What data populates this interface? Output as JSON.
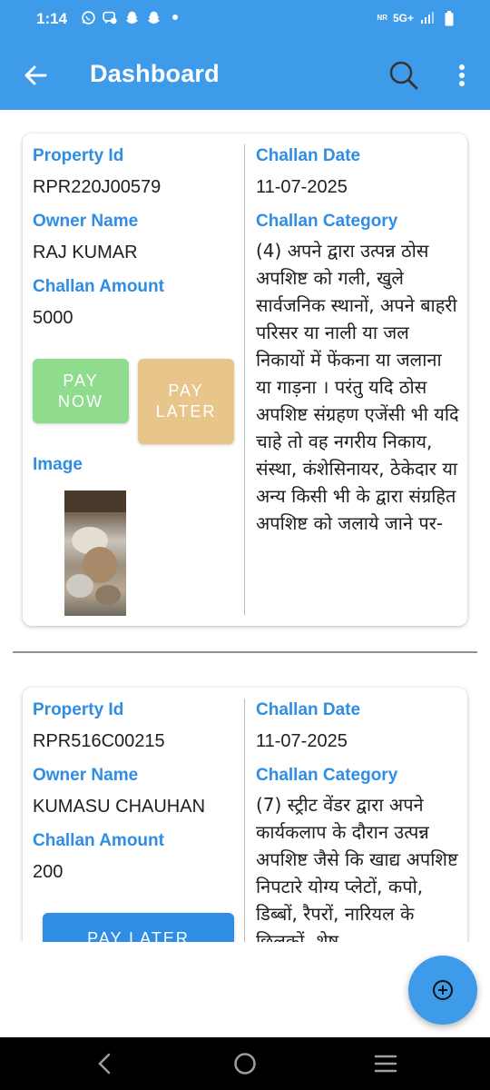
{
  "status_bar": {
    "time": "1:14",
    "left_icons": [
      "whatsapp-icon",
      "chat-icon",
      "snapchat-icon",
      "snapchat-icon",
      "dot-icon"
    ],
    "network": "5G+",
    "network_sub": "NR"
  },
  "app_bar": {
    "title": "Dashboard",
    "back_icon": "arrow-left-icon",
    "search_icon": "search-icon",
    "menu_icon": "more-vert-icon",
    "color": "#3d9be9"
  },
  "cards": [
    {
      "property_id_label": "Property Id",
      "property_id": "RPR220J00579",
      "owner_name_label": "Owner Name",
      "owner_name": "RAJ KUMAR",
      "challan_amount_label": "Challan Amount",
      "challan_amount": "5000",
      "challan_date_label": "Challan Date",
      "challan_date": "11-07-2025",
      "challan_category_label": "Challan Category",
      "challan_category": "(4) अपने द्वारा उत्पन्न ठोस अपशिष्ट को गली, खुले सार्वजनिक स्थानों, अपने बाहरी परिसर या नाली या जल निकायों में फेंकना या जलाना या गाड़ना । परंतु यदि ठोस अपशिष्ट संग्रहण एजेंसी भी यदि चाहे तो वह नगरीय निकाय, संस्था, कंशेसिनायर, ठेकेदार या अन्य किसी भी के द्वारा संग्रहित अपशिष्ट को जलाये जाने पर-",
      "pay_now_label": "PAY NOW",
      "pay_later_label": "PAY LATER",
      "image_label": "Image"
    },
    {
      "property_id_label": "Property Id",
      "property_id": "RPR516C00215",
      "owner_name_label": "Owner Name",
      "owner_name": "KUMASU CHAUHAN",
      "challan_amount_label": "Challan Amount",
      "challan_amount": "200",
      "challan_date_label": "Challan Date",
      "challan_date": "11-07-2025",
      "challan_category_label": "Challan Category",
      "challan_category": "(7) स्ट्रीट वेंडर द्वारा अपने कार्यकलाप के दौरान उत्पन्न अपशिष्ट जैसे कि खाद्य अपशिष्ट निपटारे योग्य प्लेटों, कपो, डिब्बों, रैपरों, नारियल के छिलकों, शेष",
      "pay_later_label": "PAY LATER"
    }
  ],
  "fab": {
    "icon": "add-circle-icon"
  },
  "nav_bar": {
    "back_icon": "nav-back-icon",
    "home_icon": "nav-home-icon",
    "recents_icon": "nav-recents-icon"
  }
}
